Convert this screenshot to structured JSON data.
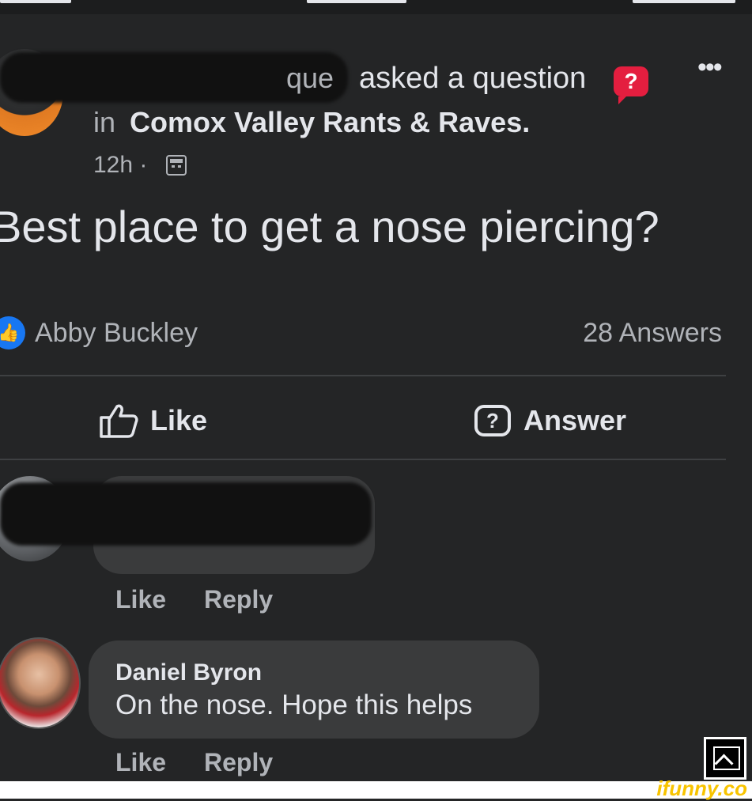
{
  "post": {
    "author_fragment": "que",
    "asked_text": "asked a question",
    "question_badge": "?",
    "more_icon": "•••",
    "in_text": "in",
    "group_name": "Comox Valley Rants & Raves.",
    "timestamp": "12h ·",
    "question": "Best place to get a nose piercing?",
    "reactor": "Abby Buckley",
    "answer_count": "28 Answers"
  },
  "actions": {
    "like_label": "Like",
    "answer_label": "Answer"
  },
  "comments": [
    {
      "like": "Like",
      "reply": "Reply"
    },
    {
      "author": "Daniel Byron",
      "text": "On the nose. Hope this helps",
      "like": "Like",
      "reply": "Reply"
    }
  ],
  "watermark": "ifunny.co",
  "colors": {
    "background": "#242526",
    "bubble": "#3a3b3c",
    "accent_like": "#1877f2",
    "badge": "#e41e3f"
  }
}
